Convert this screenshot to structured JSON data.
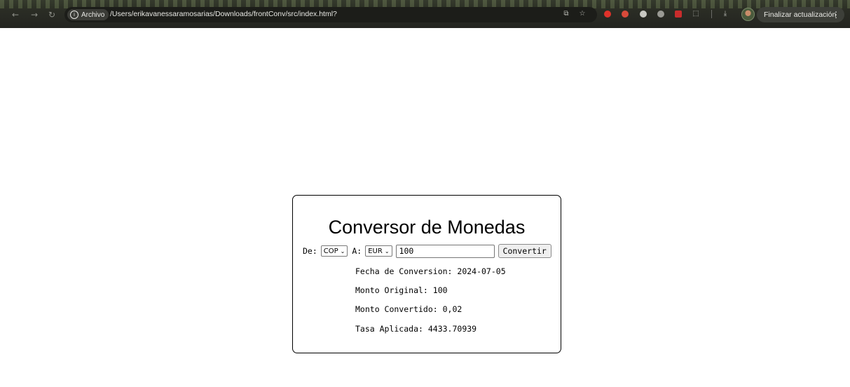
{
  "browser": {
    "url_chip_label": "Archivo",
    "url": "/Users/erikavanessaramosarias/Downloads/frontConv/src/index.html?",
    "update_button_label": "Finalizar actualización",
    "icons": [
      "back-icon",
      "forward-icon",
      "reload-icon",
      "info-icon",
      "translate-icon",
      "star-icon",
      "extension-icon",
      "download-icon",
      "avatar",
      "kebab-menu-icon"
    ],
    "colors": {
      "chrome_bg": "#2b2d25",
      "omnibox_bg": "#1c1d19"
    }
  },
  "converter": {
    "title": "Conversor de Monedas",
    "from_label": "De:",
    "from_currency": "COP",
    "to_label": "A:",
    "to_currency": "EUR",
    "amount_value": "100",
    "convert_button": "Convertir",
    "results": {
      "date": "Fecha de Conversion: 2024-07-05",
      "original": "Monto Original: 100",
      "converted": "Monto Convertido: 0,02",
      "rate": "Tasa Aplicada: 4433.70939"
    }
  }
}
